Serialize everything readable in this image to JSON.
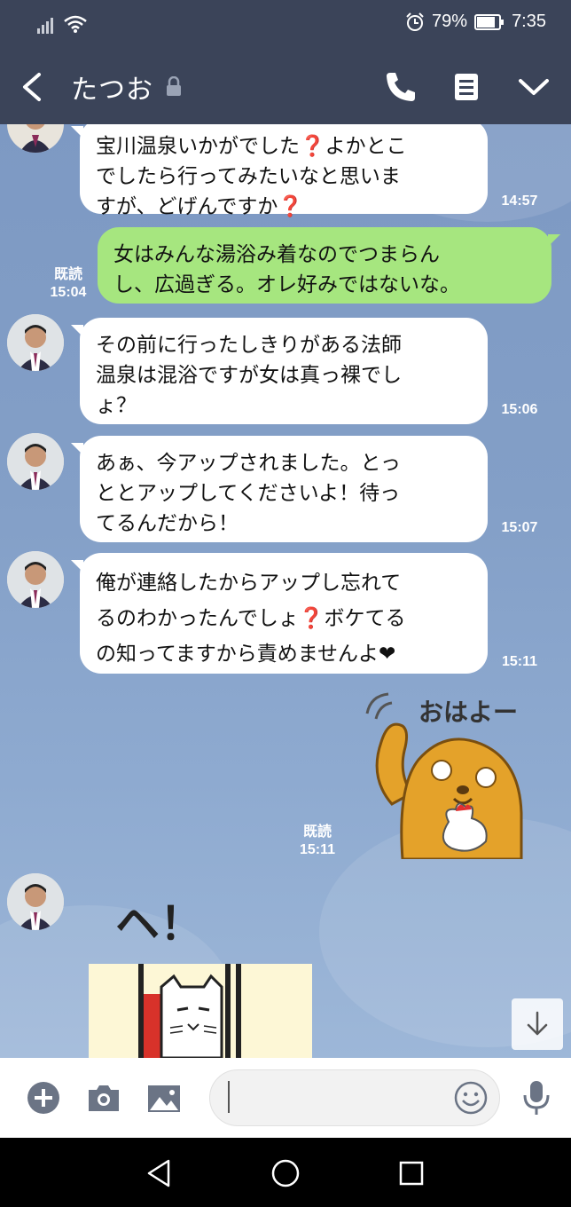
{
  "status_bar": {
    "battery": "79%",
    "time": "7:35"
  },
  "header": {
    "title": "たつお",
    "icons": [
      "back-icon",
      "lock-icon",
      "phone-icon",
      "notes-icon",
      "chevron-down-icon"
    ]
  },
  "messages": [
    {
      "side": "left",
      "text": "宝川温泉いかがでした❓よかとこ\nでしたら行ってみたいなと思いま\nすが、どげんですか❓",
      "time": "14:57"
    },
    {
      "side": "right",
      "text": "女はみんな湯浴み着なのでつまらん\nし、広過ぎる。オレ好みではないな。",
      "read": "既読",
      "time": "15:04"
    },
    {
      "side": "left",
      "text": "その前に行ったしきりがある法師\n温泉は混浴ですが女は真っ裸でし\nょ？",
      "time": "15:06"
    },
    {
      "side": "left",
      "text": "あぁ、今アップされました。とっ\nととアップしてくださいよ！待っ\nてるんだから！",
      "time": "15:07"
    },
    {
      "side": "left",
      "text": "俺が連絡したからアップし忘れて\nるのわかったんでしょ❓ボケてる\nの知ってますから責めませんよ❤",
      "time": "15:11"
    },
    {
      "side": "right",
      "sticker": "おはよー",
      "read": "既読",
      "time": "15:11"
    },
    {
      "side": "left",
      "sticker": "ヘ！"
    }
  ],
  "input_bar": {
    "placeholder": "",
    "icons": [
      "plus-icon",
      "camera-icon",
      "image-icon",
      "emoji-icon",
      "mic-icon"
    ]
  },
  "colors": {
    "header": "#3b4459",
    "bubble_sent": "#a6e67f",
    "bubble_received": "#ffffff",
    "chat_bg": "#839fc7"
  }
}
